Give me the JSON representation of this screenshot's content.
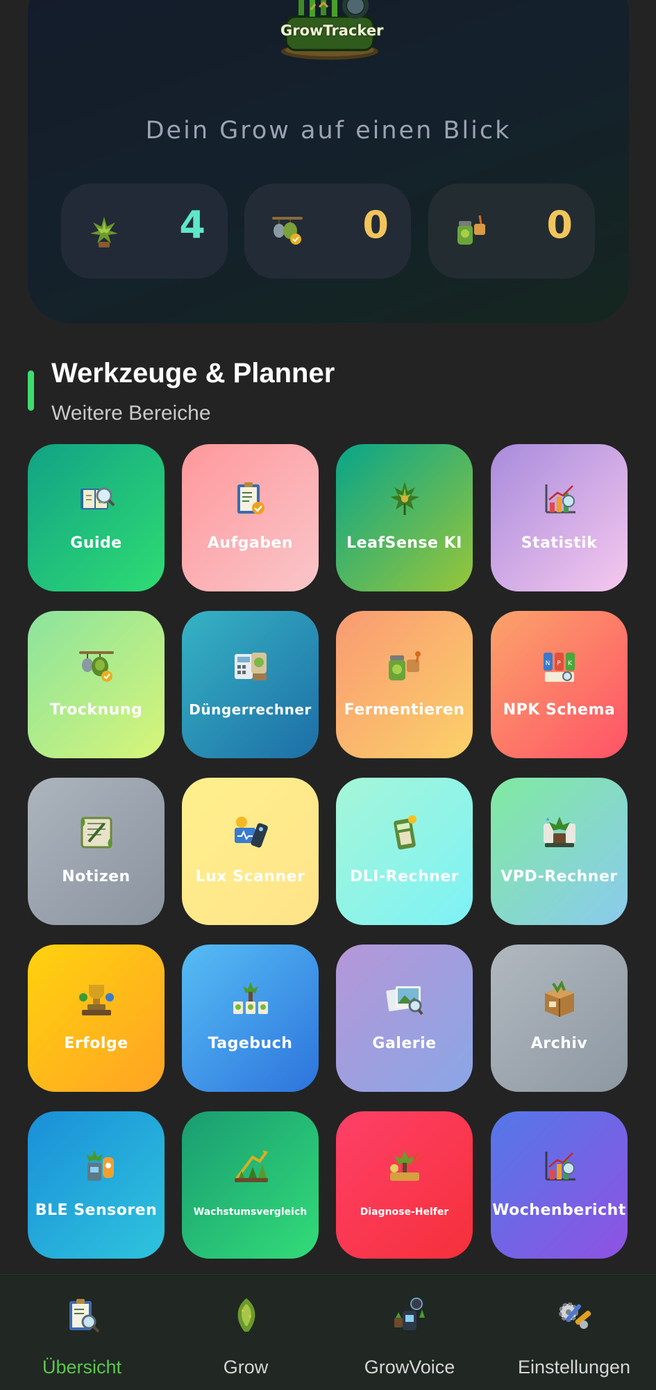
{
  "hero": {
    "logo_text": "GrowTracker",
    "tagline": "Dein Grow auf einen Blick",
    "stats": [
      {
        "icon": "plant-icon",
        "value": "4",
        "color": "#5fe6c8"
      },
      {
        "icon": "drying-icon",
        "value": "0",
        "color": "#f2c45c"
      },
      {
        "icon": "jar-icon",
        "value": "0",
        "color": "#f2c45c"
      }
    ]
  },
  "section": {
    "title": "Werkzeuge & Planner",
    "subtitle": "Weitere Bereiche",
    "accent": "#3fdc6e"
  },
  "tiles": [
    {
      "label": "Guide",
      "icon": "guide-book-icon"
    },
    {
      "label": "Aufgaben",
      "icon": "clipboard-icon"
    },
    {
      "label": "LeafSense KI",
      "icon": "leaf-ai-icon"
    },
    {
      "label": "Statistik",
      "icon": "chart-icon"
    },
    {
      "label": "Trocknung",
      "icon": "drying-rack-icon"
    },
    {
      "label": "Düngerrechner",
      "icon": "fertilizer-calculator-icon"
    },
    {
      "label": "Fermentieren",
      "icon": "jar-icon"
    },
    {
      "label": "NPK Schema",
      "icon": "npk-bottles-icon"
    },
    {
      "label": "Notizen",
      "icon": "notes-icon"
    },
    {
      "label": "Lux Scanner",
      "icon": "lux-scanner-icon"
    },
    {
      "label": "DLI-Rechner",
      "icon": "dli-calculator-icon"
    },
    {
      "label": "VPD-Rechner",
      "icon": "vpd-calculator-icon"
    },
    {
      "label": "Erfolge",
      "icon": "achievements-icon"
    },
    {
      "label": "Tagebuch",
      "icon": "diary-icon"
    },
    {
      "label": "Galerie",
      "icon": "gallery-icon"
    },
    {
      "label": "Archiv",
      "icon": "archive-box-icon"
    },
    {
      "label": "BLE Sensoren",
      "icon": "ble-sensor-icon"
    },
    {
      "label": "Wachstumsvergleich",
      "icon": "growth-compare-icon"
    },
    {
      "label": "Diagnose-Helfer",
      "icon": "diagnosis-icon"
    },
    {
      "label": "Wochenbericht",
      "icon": "weekly-report-icon"
    }
  ],
  "nav": [
    {
      "label": "Übersicht",
      "icon": "overview-icon",
      "active": true
    },
    {
      "label": "Grow",
      "icon": "grow-bud-icon",
      "active": false
    },
    {
      "label": "GrowVoice",
      "icon": "voice-icon",
      "active": false
    },
    {
      "label": "Einstellungen",
      "icon": "settings-tools-icon",
      "active": false
    }
  ],
  "colors": {
    "background": "#232323",
    "nav_active": "#5ac84a",
    "nav_inactive": "#d6d6d6"
  }
}
